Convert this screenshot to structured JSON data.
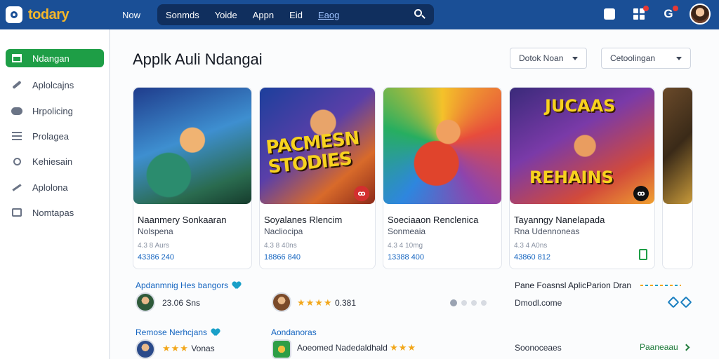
{
  "app": {
    "name": "todary"
  },
  "nav": {
    "now": "Now",
    "items": [
      "Sonmds",
      "Yoide",
      "Appn",
      "Eid",
      "Eaog"
    ]
  },
  "sidebar": {
    "items": [
      {
        "label": "Ndangan",
        "icon": "store-icon",
        "active": true
      },
      {
        "label": "Aplolcajns",
        "icon": "wrench-icon"
      },
      {
        "label": "Hrpolicing",
        "icon": "gamepad-icon"
      },
      {
        "label": "Prolagea",
        "icon": "list-icon"
      },
      {
        "label": "Kehiesain",
        "icon": "search-icon"
      },
      {
        "label": "Aplolona",
        "icon": "trending-icon"
      },
      {
        "label": "Nomtapas",
        "icon": "box-icon"
      }
    ]
  },
  "main": {
    "title": "Applk Auli Ndangai",
    "dropdown1": "Dotok Noan",
    "dropdown2": "Cetoolingan"
  },
  "cards": [
    {
      "name": "Naanmery Sonkaaran",
      "developer": "Nolspena",
      "rating": "4.3 8 Aurs",
      "count": "43386 240"
    },
    {
      "name": "Soyalanes Rlencim",
      "developer": "Nacliocipa",
      "rating": "4.3 8 40ns",
      "count": "18866 840",
      "art_text": "PACMESN STODIES",
      "badge": "ꝏ"
    },
    {
      "name": "Soeciaaon Renclenica",
      "developer": "Sonmeaia",
      "rating": "4.3 4 10mg",
      "count": "13388 400"
    },
    {
      "name": "Tayanngy Nanelapada",
      "developer": "Rna Udennoneas",
      "rating": "4.3 4 A0ns",
      "count": "43860 812",
      "art_top": "JUCAAS",
      "art_bottom": "REHAINS",
      "badge": "ꝏ"
    },
    {
      "name": "",
      "developer": "",
      "rating": "",
      "count": ""
    }
  ],
  "rows": {
    "section1": "Apdanmnig Hes bangors",
    "row1_value": "23.06 Sns",
    "row1b_value": "0.381",
    "right1_head": "Pane Foasnsl AplicParion Dran",
    "right1_value": "Dmodl.come",
    "section2": "Remose Nerhcjans",
    "section3": "Aondanoras",
    "row2_sub": "Vonas",
    "row2b_text": "Aoeomed Nadedaldhald",
    "row2_right": "Soonoceaes",
    "row2_link": "Paaneaau",
    "stars_full": "★★★★",
    "stars_small": "★★★"
  }
}
